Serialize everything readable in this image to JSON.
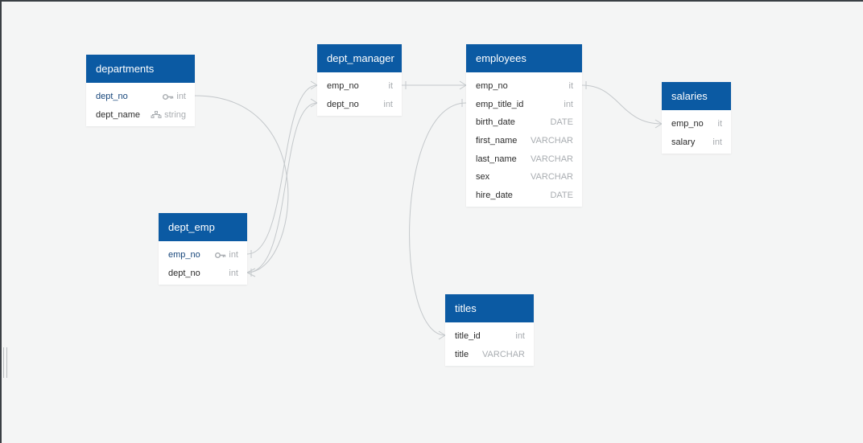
{
  "tables": {
    "departments": {
      "title": "departments",
      "columns": [
        {
          "name": "dept_no",
          "type": "int",
          "icon": "key-icon"
        },
        {
          "name": "dept_name",
          "type": "string",
          "icon": "index-icon"
        }
      ]
    },
    "dept_manager": {
      "title": "dept_manager",
      "columns": [
        {
          "name": "emp_no",
          "type": "it"
        },
        {
          "name": "dept_no",
          "type": "int"
        }
      ]
    },
    "employees": {
      "title": "employees",
      "columns": [
        {
          "name": "emp_no",
          "type": "it"
        },
        {
          "name": "emp_title_id",
          "type": "int"
        },
        {
          "name": "birth_date",
          "type": "DATE"
        },
        {
          "name": "first_name",
          "type": "VARCHAR"
        },
        {
          "name": "last_name",
          "type": "VARCHAR"
        },
        {
          "name": "sex",
          "type": "VARCHAR"
        },
        {
          "name": "hire_date",
          "type": "DATE"
        }
      ]
    },
    "salaries": {
      "title": "salaries",
      "columns": [
        {
          "name": "emp_no",
          "type": "it"
        },
        {
          "name": "salary",
          "type": "int"
        }
      ]
    },
    "dept_emp": {
      "title": "dept_emp",
      "columns": [
        {
          "name": "emp_no",
          "type": "int",
          "icon": "key-icon"
        },
        {
          "name": "dept_no",
          "type": "int"
        }
      ]
    },
    "titles": {
      "title": "titles",
      "columns": [
        {
          "name": "title_id",
          "type": "int"
        },
        {
          "name": "title",
          "type": "VARCHAR"
        }
      ]
    }
  },
  "colors": {
    "header": "#0b5aa3",
    "primary_key_text": "#16457a",
    "connector": "#c4c8cb",
    "canvas": "#f4f5f5"
  }
}
